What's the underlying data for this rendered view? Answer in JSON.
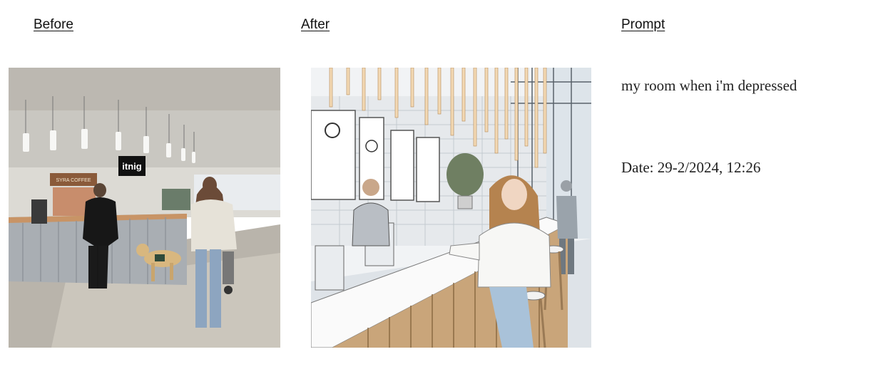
{
  "columns": {
    "before_label": "Before",
    "after_label": "After",
    "prompt_label": "Prompt"
  },
  "before_image": {
    "sign_text": "itnig",
    "menu_text": "SYRA COFFEE"
  },
  "prompt": {
    "text": "my room when i'm depressed",
    "date": "Date: 29-2/2024, 12:26"
  }
}
